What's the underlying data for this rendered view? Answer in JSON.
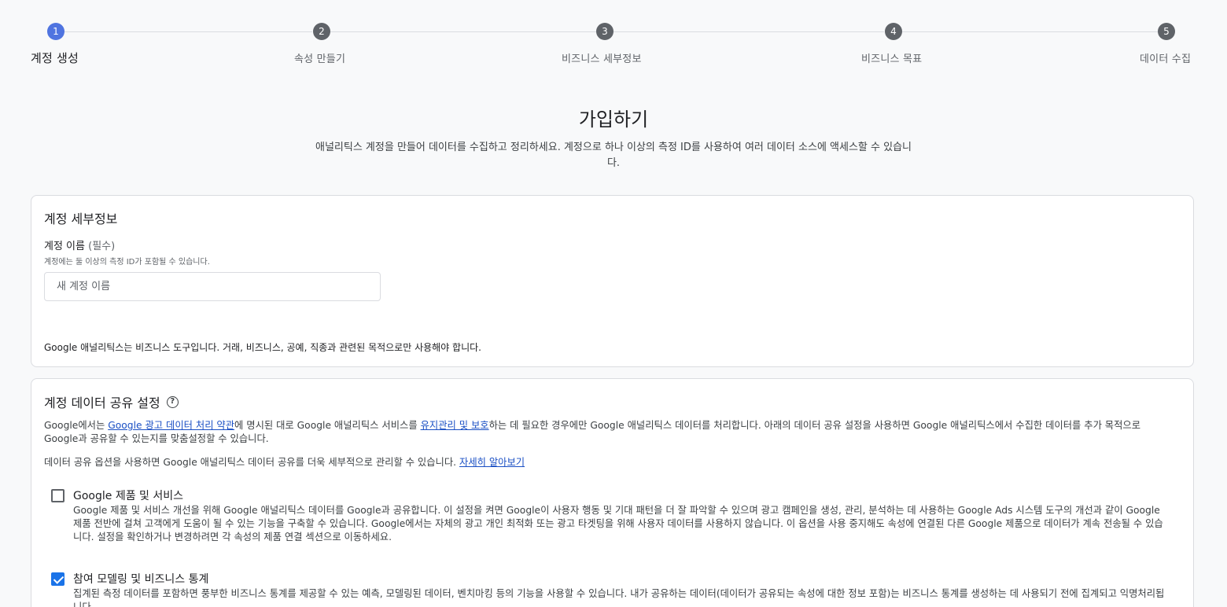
{
  "stepper": {
    "steps": [
      {
        "number": "1",
        "label": "계정 생성",
        "active": true
      },
      {
        "number": "2",
        "label": "속성 만들기",
        "active": false
      },
      {
        "number": "3",
        "label": "비즈니스 세부정보",
        "active": false
      },
      {
        "number": "4",
        "label": "비즈니스 목표",
        "active": false
      },
      {
        "number": "5",
        "label": "데이터 수집",
        "active": false
      }
    ],
    "active_color": "#4f74e0",
    "inactive_color": "#5f6368"
  },
  "header": {
    "title": "가입하기",
    "subtitle": "애널리틱스 계정을 만들어 데이터를 수집하고 정리하세요. 계정으로 하나 이상의 측정 ID를 사용하여 여러 데이터 소스에 액세스할 수 있습니다."
  },
  "account_details": {
    "title": "계정 세부정보",
    "name_label": "계정 이름",
    "name_required": "(필수)",
    "name_hint": "계정에는 둘 이상의 측정 ID가 포함될 수 있습니다.",
    "name_placeholder": "새 계정 이름",
    "name_value": "",
    "usage_note": "Google 애널리틱스는 비즈니스 도구입니다. 거래, 비즈니스, 공예, 직종과 관련된 목적으로만 사용해야 합니다."
  },
  "data_sharing": {
    "title": "계정 데이터 공유 설정",
    "help_icon": "help-circle-icon",
    "intro_prefix": "Google에서는 ",
    "intro_link_terms": "Google 광고 데이터 처리 약관",
    "intro_mid": "에 명시된 대로 Google 애널리틱스 서비스를 ",
    "intro_link_maintain": "유지관리 및 보호",
    "intro_suffix": "하는 데 필요한 경우에만 Google 애널리틱스 데이터를 처리합니다. 아래의 데이터 공유 설정을 사용하면 Google 애널리틱스에서 수집한 데이터를 추가 목적으로 Google과 공유할 수 있는지를 맞춤설정할 수 있습니다.",
    "options_note": "데이터 공유 옵션을 사용하면 Google 애널리틱스 데이터 공유를 더욱 세부적으로 관리할 수 있습니다. ",
    "learn_more_link": "자세히 알아보기",
    "options": [
      {
        "title": "Google 제품 및 서비스",
        "checked": false,
        "description": "Google 제품 및 서비스 개선을 위해 Google 애널리틱스 데이터를 Google과 공유합니다. 이 설정을 켜면 Google이 사용자 행동 및 기대 패턴을 더 잘 파악할 수 있으며 광고 캠페인을 생성, 관리, 분석하는 데 사용하는 Google Ads 시스템 도구의 개선과 같이 Google 제품 전반에 걸쳐 고객에게 도움이 될 수 있는 기능을 구축할 수 있습니다. Google에서는 자체의 광고 개인 최적화 또는 광고 타겟팅을 위해 사용자 데이터를 사용하지 않습니다. 이 옵션을 사용 중지해도 속성에 연결된 다른 Google 제품으로 데이터가 계속 전송될 수 있습니다. 설정을 확인하거나 변경하려면 각 속성의 제품 연결 섹션으로 이동하세요."
      },
      {
        "title": "참여 모델링 및 비즈니스 통계",
        "checked": true,
        "description": "집계된 측정 데이터를 포함하면 풍부한 비즈니스 통계를 제공할 수 있는 예측, 모델링된 데이터, 벤치마킹 등의 기능을 사용할 수 있습니다. 내가 공유하는 데이터(데이터가 공유되는 속성에 대한 정보 포함)는 비즈니스 통계를 생성하는 데 사용되기 전에 집계되고 익명처리됩니다."
      }
    ]
  }
}
